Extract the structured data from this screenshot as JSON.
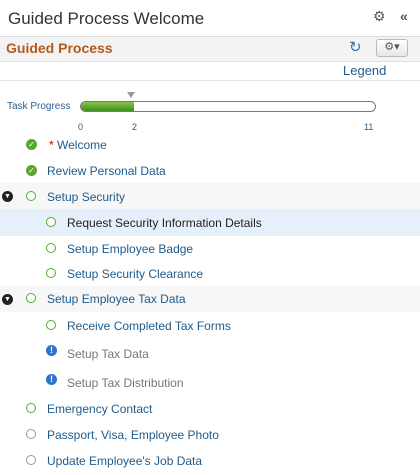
{
  "window": {
    "title": "Guided Process Welcome"
  },
  "header": {
    "title": "Guided Process"
  },
  "legend_label": "Legend",
  "progress": {
    "label": "Task Progress",
    "start": "0",
    "current": "2",
    "end": "11",
    "fraction": 0.18
  },
  "steps": [
    {
      "label": "Welcome",
      "required_marker": "*",
      "status": "complete"
    },
    {
      "label": "Review Personal Data",
      "status": "complete"
    },
    {
      "label": "Setup Security",
      "status": "in-progress",
      "expanded": true
    },
    {
      "label": "Request Security Information Details",
      "status": "in-progress",
      "selected": true
    },
    {
      "label": "Setup Employee Badge",
      "status": "in-progress"
    },
    {
      "label": "Setup Security Clearance",
      "status": "in-progress"
    },
    {
      "label": "Setup Employee Tax Data",
      "status": "in-progress",
      "expanded": true
    },
    {
      "label": "Receive Completed Tax Forms",
      "status": "in-progress"
    },
    {
      "label": "Setup Tax Data",
      "status": "info"
    },
    {
      "label": "Setup Tax Distribution",
      "status": "info"
    },
    {
      "label": "Emergency Contact",
      "status": "in-progress"
    },
    {
      "label": "Passport, Visa, Employee Photo",
      "status": "not-started"
    },
    {
      "label": "Update Employee's Job Data",
      "status": "not-started"
    }
  ]
}
